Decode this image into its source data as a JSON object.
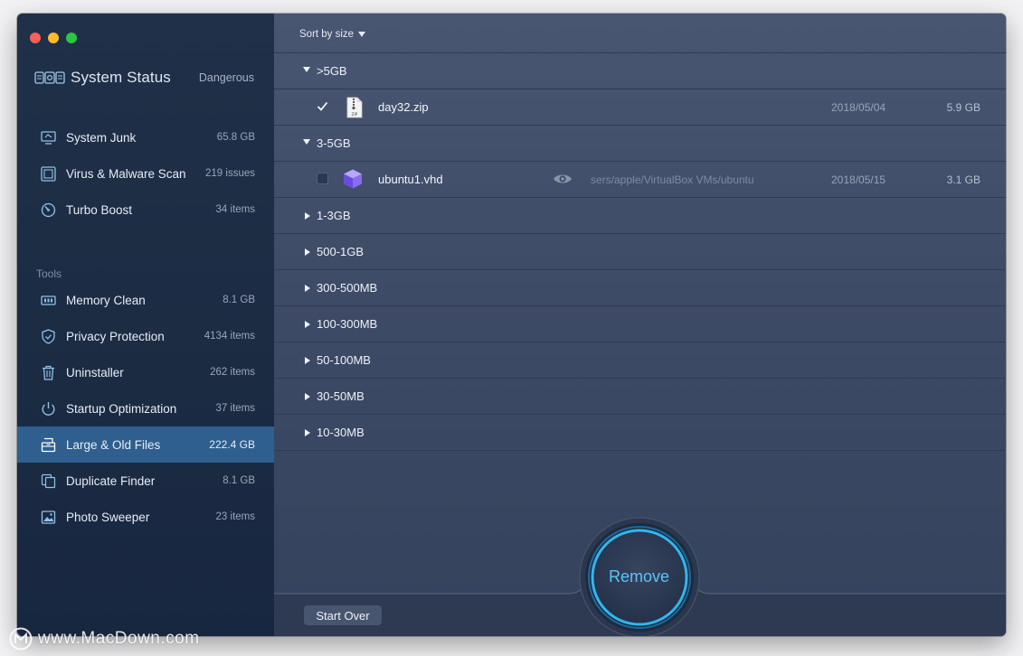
{
  "sidebar": {
    "status": {
      "title": "System Status",
      "value": "Dangerous"
    },
    "top_items": [
      {
        "label": "System Junk",
        "count": "65.8 GB",
        "icon": "monitor-icon"
      },
      {
        "label": "Virus & Malware Scan",
        "count": "219 issues",
        "icon": "shield-scan-icon"
      },
      {
        "label": "Turbo Boost",
        "count": "34 items",
        "icon": "speedometer-icon"
      }
    ],
    "tools_heading": "Tools",
    "tool_items": [
      {
        "label": "Memory Clean",
        "count": "8.1 GB",
        "icon": "memory-chip-icon"
      },
      {
        "label": "Privacy Protection",
        "count": "4134 items",
        "icon": "privacy-shield-icon"
      },
      {
        "label": "Uninstaller",
        "count": "262 items",
        "icon": "trash-icon"
      },
      {
        "label": "Startup Optimization",
        "count": "37 items",
        "icon": "power-icon"
      },
      {
        "label": "Large & Old Files",
        "count": "222.4 GB",
        "icon": "file-cabinet-icon",
        "active": true
      },
      {
        "label": "Duplicate Finder",
        "count": "8.1 GB",
        "icon": "duplicate-icon"
      },
      {
        "label": "Photo Sweeper",
        "count": "23 items",
        "icon": "photo-icon"
      }
    ]
  },
  "main": {
    "sort_label": "Sort by size",
    "groups": [
      {
        "label": ">5GB",
        "expanded": true,
        "files": [
          {
            "name": "day32.zip",
            "date": "2018/05/04",
            "size": "5.9 GB",
            "checked": true,
            "icon": "zip-file-icon",
            "path": ""
          }
        ]
      },
      {
        "label": "3-5GB",
        "expanded": true,
        "files": [
          {
            "name": "ubuntu1.vhd",
            "date": "2018/05/15",
            "size": "3.1 GB",
            "checked": false,
            "icon": "virtualbox-cube-icon",
            "path": "sers/apple/VirtualBox VMs/ubuntu"
          }
        ]
      },
      {
        "label": "1-3GB",
        "expanded": false
      },
      {
        "label": "500-1GB",
        "expanded": false
      },
      {
        "label": "300-500MB",
        "expanded": false
      },
      {
        "label": "100-300MB",
        "expanded": false
      },
      {
        "label": "50-100MB",
        "expanded": false
      },
      {
        "label": "30-50MB",
        "expanded": false
      },
      {
        "label": "10-30MB",
        "expanded": false
      }
    ],
    "start_over_label": "Start Over",
    "remove_label": "Remove"
  },
  "watermark": "www.MacDown.com",
  "colors": {
    "accent": "#5cc4f4",
    "sidebar_active": "#2f5f8e",
    "sidebar_bg": "#1d2d45",
    "main_bg": "#3e4b67"
  }
}
